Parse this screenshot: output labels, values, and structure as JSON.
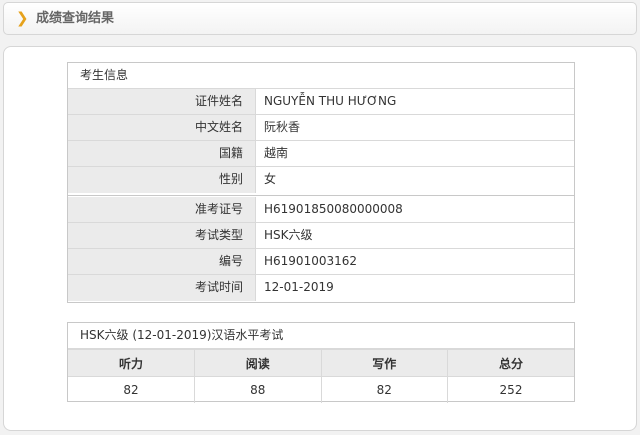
{
  "header": {
    "title": "成绩查询结果"
  },
  "info": {
    "section_title": "考生信息",
    "rows": [
      {
        "label": "证件姓名",
        "value": "NGUYỄN THU HƯƠNG"
      },
      {
        "label": "中文姓名",
        "value": "阮秋香"
      },
      {
        "label": "国籍",
        "value": "越南"
      },
      {
        "label": "性别",
        "value": "女"
      },
      {
        "label": "准考证号",
        "value": "H61901850080000008"
      },
      {
        "label": "考试类型",
        "value": "HSK六级"
      },
      {
        "label": "编号",
        "value": "H61901003162"
      },
      {
        "label": "考试时间",
        "value": "12-01-2019"
      }
    ]
  },
  "scores": {
    "section_title": "HSK六级 (12-01-2019)汉语水平考试",
    "columns": [
      "听力",
      "阅读",
      "写作",
      "总分"
    ],
    "values": [
      "82",
      "88",
      "82",
      "252"
    ]
  },
  "colors": {
    "accent": "#e6a21c",
    "label_bg": "#ebebeb",
    "border": "#c8c8c8"
  }
}
